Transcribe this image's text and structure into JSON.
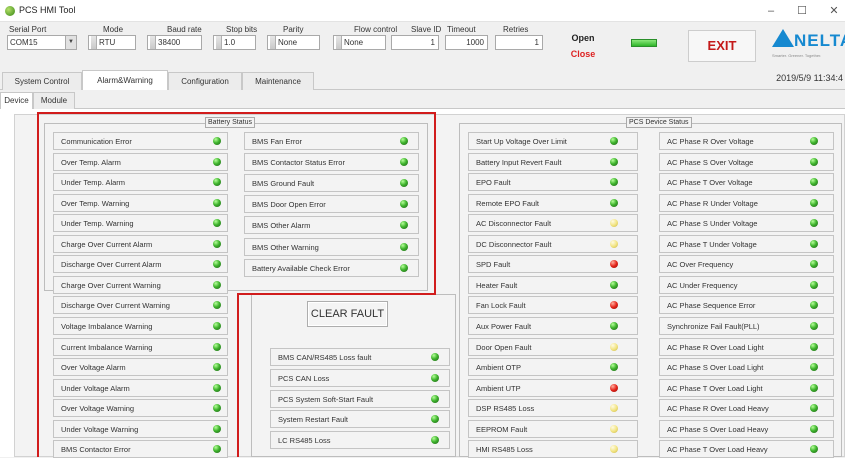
{
  "window": {
    "title": "PCS HMI Tool",
    "min": "–",
    "max": "☐",
    "close": "✕"
  },
  "conn": {
    "serial_port": {
      "label": "Serial Port",
      "value": "COM15"
    },
    "mode": {
      "label": "Mode",
      "value": "RTU"
    },
    "baud": {
      "label": "Baud rate",
      "value": "38400"
    },
    "stopbits": {
      "label": "Stop bits",
      "value": "1.0"
    },
    "parity": {
      "label": "Parity",
      "value": "None"
    },
    "flow": {
      "label": "Flow control",
      "value": "None"
    },
    "slave": {
      "label": "Slave ID",
      "value": "1"
    },
    "timeout": {
      "label": "Timeout",
      "value": "1000"
    },
    "retries": {
      "label": "Retries",
      "value": "1"
    },
    "open": "Open",
    "close": "Close",
    "exit": "EXIT"
  },
  "logo": {
    "text": "NELTA",
    "slogan": "Smarter. Greener. Together."
  },
  "tabs": [
    "System Control",
    "Alarm&Warning",
    "Configuration",
    "Maintenance"
  ],
  "active_tab": "Alarm&Warning",
  "datetime": "2019/5/9 11:34:4",
  "subtabs": [
    "Device",
    "Module"
  ],
  "battery": {
    "title": "Battery Status",
    "left": [
      {
        "label": "Communication Error",
        "led": "green"
      },
      {
        "label": "Over Temp. Alarm",
        "led": "green"
      },
      {
        "label": "Under Temp. Alarm",
        "led": "green"
      },
      {
        "label": "Over Temp. Warning",
        "led": "green"
      },
      {
        "label": "Under Temp. Warning",
        "led": "green"
      },
      {
        "label": "Charge Over Current Alarm",
        "led": "green"
      },
      {
        "label": "Discharge Over Current Alarm",
        "led": "green"
      },
      {
        "label": "Charge Over Current Warning",
        "led": "green"
      },
      {
        "label": "Discharge Over Current Warning",
        "led": "green"
      },
      {
        "label": "Voltage Imbalance Warning",
        "led": "green"
      },
      {
        "label": "Current Imbalance Warning",
        "led": "green"
      },
      {
        "label": "Over Voltage Alarm",
        "led": "green"
      },
      {
        "label": "Under Voltage Alarm",
        "led": "green"
      },
      {
        "label": "Over Voltage Warning",
        "led": "green"
      },
      {
        "label": "Under Voltage Warning",
        "led": "green"
      },
      {
        "label": "BMS Contactor Error",
        "led": "green"
      }
    ],
    "right": [
      {
        "label": "BMS Fan Error",
        "led": "green"
      },
      {
        "label": "BMS Contactor Status Error",
        "led": "green"
      },
      {
        "label": "BMS Ground Fault",
        "led": "green"
      },
      {
        "label": "BMS Door Open Error",
        "led": "green"
      },
      {
        "label": "BMS Other Alarm",
        "led": "green"
      },
      {
        "label": "BMS Other Warning",
        "led": "green"
      },
      {
        "label": "Battery Available Check Error",
        "led": "green"
      }
    ],
    "lower": [
      {
        "label": "BMS CAN/RS485 Loss fault",
        "led": "green"
      },
      {
        "label": "PCS CAN Loss",
        "led": "green"
      },
      {
        "label": "PCS System Soft-Start Fault",
        "led": "green"
      },
      {
        "label": "System Restart Fault",
        "led": "green"
      },
      {
        "label": "LC RS485 Loss",
        "led": "green"
      }
    ]
  },
  "clear_fault": "CLEAR FAULT",
  "pcs": {
    "title": "PCS Device Status",
    "left": [
      {
        "label": "Start Up Voltage Over Limit",
        "led": "green"
      },
      {
        "label": "Battery Input Revert Fault",
        "led": "green"
      },
      {
        "label": "EPO Fault",
        "led": "green"
      },
      {
        "label": "Remote EPO Fault",
        "led": "green"
      },
      {
        "label": "AC Disconnector Fault",
        "led": "yellow"
      },
      {
        "label": "DC Disconnector Fault",
        "led": "yellow"
      },
      {
        "label": "SPD Fault",
        "led": "red"
      },
      {
        "label": "Heater Fault",
        "led": "green"
      },
      {
        "label": "Fan Lock Fault",
        "led": "red"
      },
      {
        "label": "Aux Power Fault",
        "led": "green"
      },
      {
        "label": "Door Open Fault",
        "led": "yellow"
      },
      {
        "label": "Ambient OTP",
        "led": "green"
      },
      {
        "label": "Ambient UTP",
        "led": "red"
      },
      {
        "label": "DSP RS485 Loss",
        "led": "yellow"
      },
      {
        "label": "EEPROM Fault",
        "led": "yellow"
      },
      {
        "label": "HMI RS485 Loss",
        "led": "yellow"
      }
    ],
    "right": [
      {
        "label": "AC Phase R Over Voltage",
        "led": "green"
      },
      {
        "label": "AC Phase S Over Voltage",
        "led": "green"
      },
      {
        "label": "AC Phase T Over Voltage",
        "led": "green"
      },
      {
        "label": "AC Phase R Under Voltage",
        "led": "green"
      },
      {
        "label": "AC Phase S Under Voltage",
        "led": "green"
      },
      {
        "label": "AC Phase T Under Voltage",
        "led": "green"
      },
      {
        "label": "AC Over Frequency",
        "led": "green"
      },
      {
        "label": "AC Under Frequency",
        "led": "green"
      },
      {
        "label": "AC Phase Sequence Error",
        "led": "green"
      },
      {
        "label": "Synchronize Fail Fault(PLL)",
        "led": "green"
      },
      {
        "label": "AC Phase R Over Load Light",
        "led": "green"
      },
      {
        "label": "AC Phase S Over Load Light",
        "led": "green"
      },
      {
        "label": "AC Phase T Over Load Light",
        "led": "green"
      },
      {
        "label": "AC Phase R Over Load Heavy",
        "led": "green"
      },
      {
        "label": "AC Phase S Over Load Heavy",
        "led": "green"
      },
      {
        "label": "AC Phase T Over Load Heavy",
        "led": "green"
      }
    ]
  }
}
